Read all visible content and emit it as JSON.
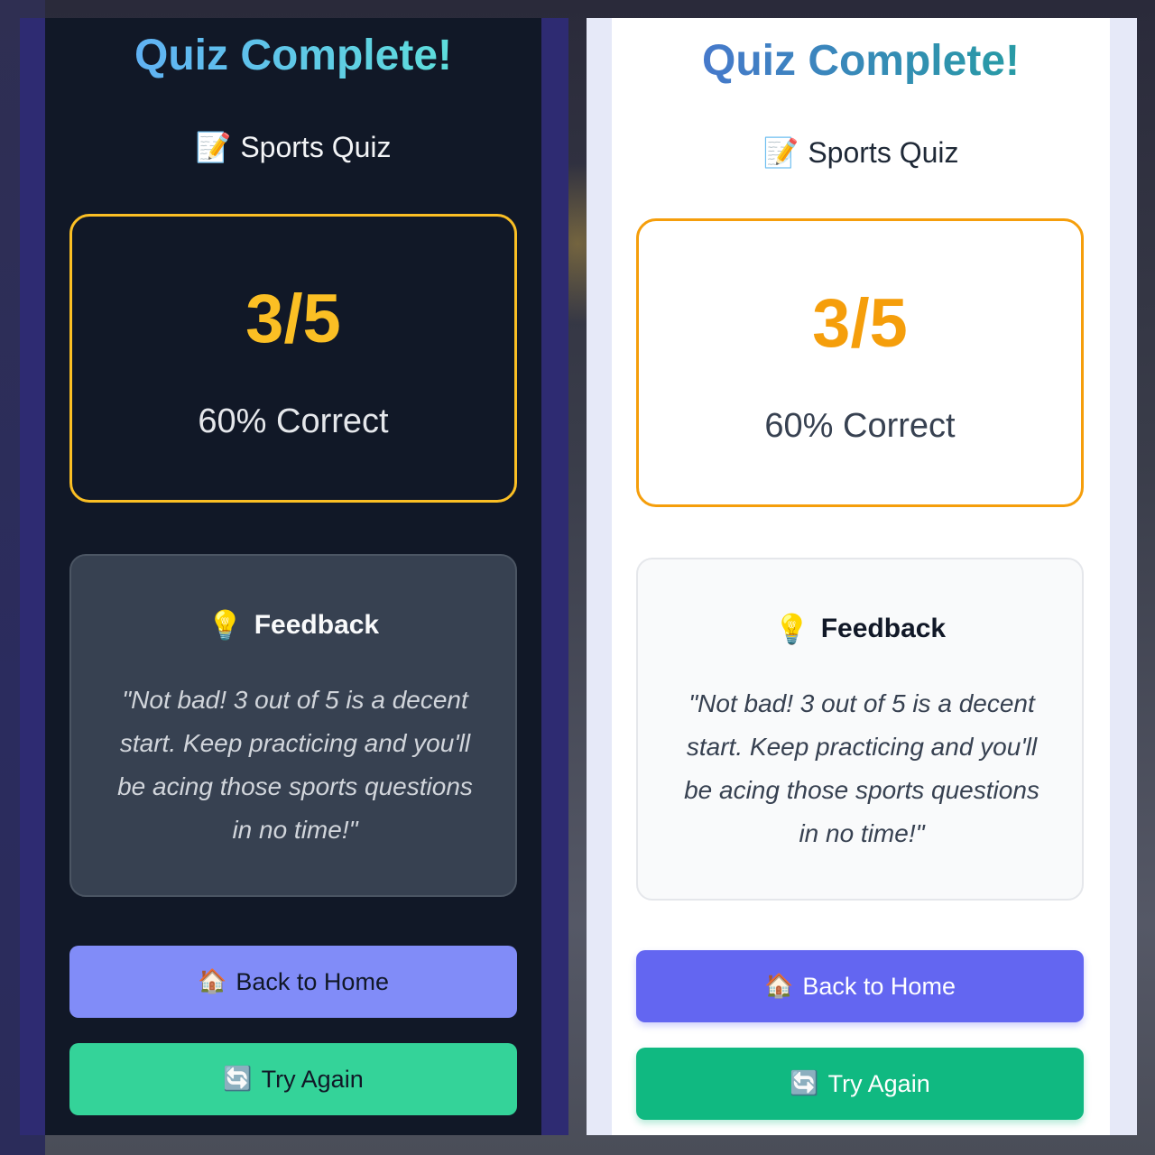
{
  "screens": {
    "dark": {
      "title": "Quiz Complete!",
      "quiz_icon": "📝",
      "quiz_name": "Sports Quiz",
      "score": "3/5",
      "percent_text": "60% Correct",
      "feedback_icon": "💡",
      "feedback_heading": "Feedback",
      "feedback_text": "\"Not bad! 3 out of 5 is a decent start. Keep practicing and you'll be acing those sports questions in no time!\"",
      "home_icon": "🏠",
      "home_label": "Back to Home",
      "retry_icon": "🔄",
      "retry_label": "Try Again"
    },
    "light": {
      "title": "Quiz Complete!",
      "quiz_icon": "📝",
      "quiz_name": "Sports Quiz",
      "score": "3/5",
      "percent_text": "60% Correct",
      "feedback_icon": "💡",
      "feedback_heading": "Feedback",
      "feedback_text": "\"Not bad! 3 out of 5 is a decent start. Keep practicing and you'll be acing those sports questions in no time!\"",
      "home_icon": "🏠",
      "home_label": "Back to Home",
      "retry_icon": "🔄",
      "retry_label": "Try Again"
    }
  },
  "colors": {
    "dark_bg": "#111827",
    "dark_score": "#fbbf24",
    "dark_home_button": "#818cf8",
    "dark_retry_button": "#34d399",
    "light_bg": "#ffffff",
    "light_score": "#f59e0b",
    "light_home_button": "#6366f1",
    "light_retry_button": "#10b981"
  },
  "icons": {
    "quiz": "memo-icon",
    "feedback": "lightbulb-icon",
    "home": "house-icon",
    "retry": "refresh-icon"
  }
}
